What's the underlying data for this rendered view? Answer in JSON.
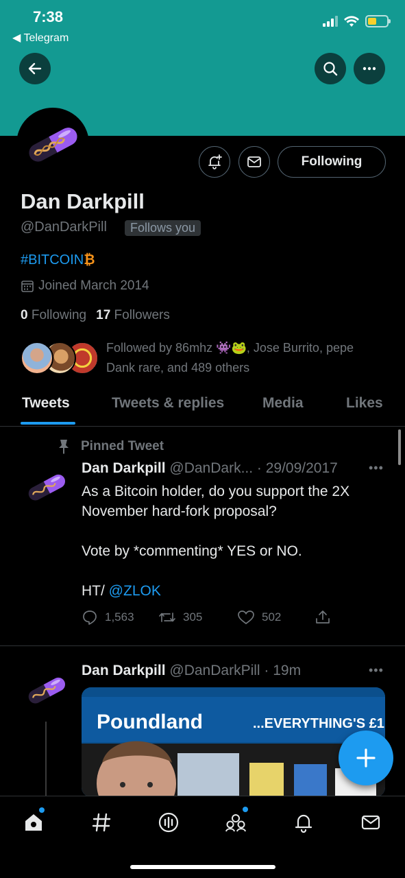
{
  "status_bar": {
    "time": "7:38",
    "back_label": "Telegram"
  },
  "profile": {
    "display_name": "Dan Darkpill",
    "handle": "@DanDarkPill",
    "follows_you_badge": "Follows you",
    "bio_hashtag": "#BITCOIN",
    "bio_emoji": "₿",
    "joined": "Joined March 2014",
    "following_count": "0",
    "following_label": "Following",
    "followers_count": "17",
    "followers_label": "Followers",
    "following_button_label": "Following",
    "followed_by_line1": "Followed by 86mhz 👾🐸, Jose Burrito, pepe",
    "followed_by_line2": "Dank rare, and 489 others"
  },
  "tabs": [
    "Tweets",
    "Tweets & replies",
    "Media",
    "Likes"
  ],
  "tweets": [
    {
      "pinned_label": "Pinned Tweet",
      "name": "Dan Darkpill",
      "meta": "@DanDark... · 29/09/2017",
      "body_line1": "As a Bitcoin holder, do you support the 2X",
      "body_line2": "November hard-fork proposal?",
      "body_line3": "Vote by *commenting* YES or NO.",
      "body_prefix": "HT/ ",
      "body_mention": "@ZLOK",
      "replies": "1,563",
      "retweets": "305",
      "likes": "502"
    },
    {
      "name": "Dan Darkpill",
      "meta": "@DanDarkPill · 19m",
      "media_brand": "Poundland",
      "media_tagline": "...EVERYTHING'S £1"
    }
  ],
  "colors": {
    "banner": "#139a92",
    "accent": "#1d9bf0",
    "bitcoin": "#f7931a"
  }
}
